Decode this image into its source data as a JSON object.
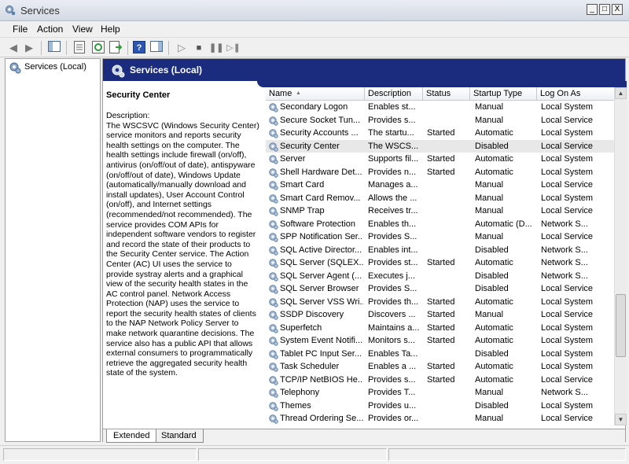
{
  "window": {
    "title": "Services",
    "min": "_",
    "max": "□",
    "close": "X"
  },
  "menu": [
    "File",
    "Action",
    "View",
    "Help"
  ],
  "tree": {
    "root": "Services (Local)"
  },
  "header": {
    "title": "Services (Local)"
  },
  "description": {
    "service_name": "Security Center",
    "label": "Description:",
    "text": "The WSCSVC (Windows Security Center) service monitors and reports security health settings on the computer.  The health settings include firewall (on/off), antivirus (on/off/out of date), antispyware (on/off/out of date), Windows Update (automatically/manually download and install updates), User Account Control (on/off), and Internet settings (recommended/not recommended). The service provides COM APIs for independent software vendors to register and record the state of their products to the Security Center service.  The Action Center (AC) UI uses the service to provide systray alerts and a graphical view of the security health states in the AC control panel.  Network Access Protection (NAP) uses the service to report the security health states of clients to the NAP Network Policy Server to make network quarantine decisions.  The service also has a public API that allows external consumers to programmatically retrieve the aggregated security health state of the system."
  },
  "columns": [
    "Name",
    "Description",
    "Status",
    "Startup Type",
    "Log On As"
  ],
  "sort_arrow": "▲",
  "rows": [
    {
      "name": "Secondary Logon",
      "desc": "Enables st...",
      "status": "",
      "startup": "Manual",
      "logon": "Local System"
    },
    {
      "name": "Secure Socket Tun...",
      "desc": "Provides s...",
      "status": "",
      "startup": "Manual",
      "logon": "Local Service"
    },
    {
      "name": "Security Accounts ...",
      "desc": "The startu...",
      "status": "Started",
      "startup": "Automatic",
      "logon": "Local System"
    },
    {
      "name": "Security Center",
      "desc": "The WSCS...",
      "status": "",
      "startup": "Disabled",
      "logon": "Local Service",
      "selected": true
    },
    {
      "name": "Server",
      "desc": "Supports fil...",
      "status": "Started",
      "startup": "Automatic",
      "logon": "Local System"
    },
    {
      "name": "Shell Hardware Det...",
      "desc": "Provides n...",
      "status": "Started",
      "startup": "Automatic",
      "logon": "Local System"
    },
    {
      "name": "Smart Card",
      "desc": "Manages a...",
      "status": "",
      "startup": "Manual",
      "logon": "Local Service"
    },
    {
      "name": "Smart Card Remov...",
      "desc": "Allows the ...",
      "status": "",
      "startup": "Manual",
      "logon": "Local System"
    },
    {
      "name": "SNMP Trap",
      "desc": "Receives tr...",
      "status": "",
      "startup": "Manual",
      "logon": "Local Service"
    },
    {
      "name": "Software Protection",
      "desc": "Enables th...",
      "status": "",
      "startup": "Automatic (D...",
      "logon": "Network S..."
    },
    {
      "name": "SPP Notification Ser...",
      "desc": "Provides S...",
      "status": "",
      "startup": "Manual",
      "logon": "Local Service"
    },
    {
      "name": "SQL Active Director...",
      "desc": "Enables int...",
      "status": "",
      "startup": "Disabled",
      "logon": "Network S..."
    },
    {
      "name": "SQL Server (SQLEX...",
      "desc": "Provides st...",
      "status": "Started",
      "startup": "Automatic",
      "logon": "Network S..."
    },
    {
      "name": "SQL Server Agent (...",
      "desc": "Executes j...",
      "status": "",
      "startup": "Disabled",
      "logon": "Network S..."
    },
    {
      "name": "SQL Server Browser",
      "desc": "Provides S...",
      "status": "",
      "startup": "Disabled",
      "logon": "Local Service"
    },
    {
      "name": "SQL Server VSS Wri...",
      "desc": "Provides th...",
      "status": "Started",
      "startup": "Automatic",
      "logon": "Local System"
    },
    {
      "name": "SSDP Discovery",
      "desc": "Discovers ...",
      "status": "Started",
      "startup": "Manual",
      "logon": "Local Service"
    },
    {
      "name": "Superfetch",
      "desc": "Maintains a...",
      "status": "Started",
      "startup": "Automatic",
      "logon": "Local System"
    },
    {
      "name": "System Event Notifi...",
      "desc": "Monitors s...",
      "status": "Started",
      "startup": "Automatic",
      "logon": "Local System"
    },
    {
      "name": "Tablet PC Input Ser...",
      "desc": "Enables Ta...",
      "status": "",
      "startup": "Disabled",
      "logon": "Local System"
    },
    {
      "name": "Task Scheduler",
      "desc": "Enables a ...",
      "status": "Started",
      "startup": "Automatic",
      "logon": "Local System"
    },
    {
      "name": "TCP/IP NetBIOS He...",
      "desc": "Provides s...",
      "status": "Started",
      "startup": "Automatic",
      "logon": "Local Service"
    },
    {
      "name": "Telephony",
      "desc": "Provides T...",
      "status": "",
      "startup": "Manual",
      "logon": "Network S..."
    },
    {
      "name": "Themes",
      "desc": "Provides u...",
      "status": "",
      "startup": "Disabled",
      "logon": "Local System"
    },
    {
      "name": "Thread Ordering Se...",
      "desc": "Provides or...",
      "status": "",
      "startup": "Manual",
      "logon": "Local Service"
    }
  ],
  "tabs": [
    "Extended",
    "Standard"
  ],
  "colors": {
    "header_bg": "#1b2c7e",
    "selected_row": "#e8e8e8"
  }
}
